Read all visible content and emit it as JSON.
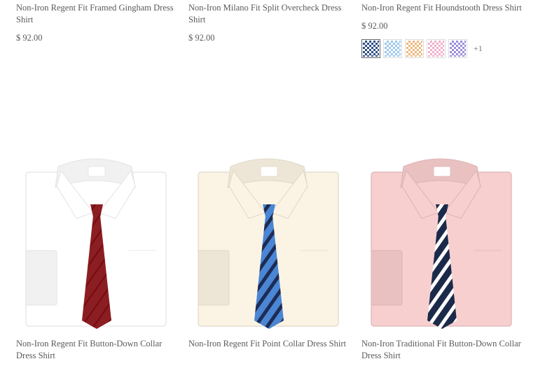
{
  "products_top": [
    {
      "title": "Non-Iron Regent Fit Framed Gingham Dress Shirt",
      "price": "$ 92.00"
    },
    {
      "title": "Non-Iron Milano Fit Split Overcheck Dress Shirt",
      "price": "$ 92.00"
    },
    {
      "title": "Non-Iron Regent Fit Houndstooth Dress Shirt",
      "price": "$ 92.00",
      "swatches": [
        {
          "name": "navy houndstooth",
          "color": "#2f4f86"
        },
        {
          "name": "light blue houndstooth",
          "color": "#9cc6ee"
        },
        {
          "name": "orange houndstooth",
          "color": "#f0b77c"
        },
        {
          "name": "pink houndstooth",
          "color": "#efb0cc"
        },
        {
          "name": "lavender houndstooth",
          "color": "#9b8dd6"
        }
      ],
      "more_swatches": "+1"
    }
  ],
  "products_bottom": [
    {
      "title": "Non-Iron Regent Fit Button-Down Collar Dress Shirt",
      "shirt_color": "#ffffff",
      "tie_color": "#8b1e22"
    },
    {
      "title": "Non-Iron Regent Fit Point Collar Dress Shirt",
      "shirt_color": "#fbf4e4",
      "tie_color": "#4a86d4"
    },
    {
      "title": "Non-Iron Traditional Fit Button-Down Collar Dress Shirt",
      "shirt_color": "#f8cfcf",
      "tie_color": "#1c2a4a"
    }
  ]
}
